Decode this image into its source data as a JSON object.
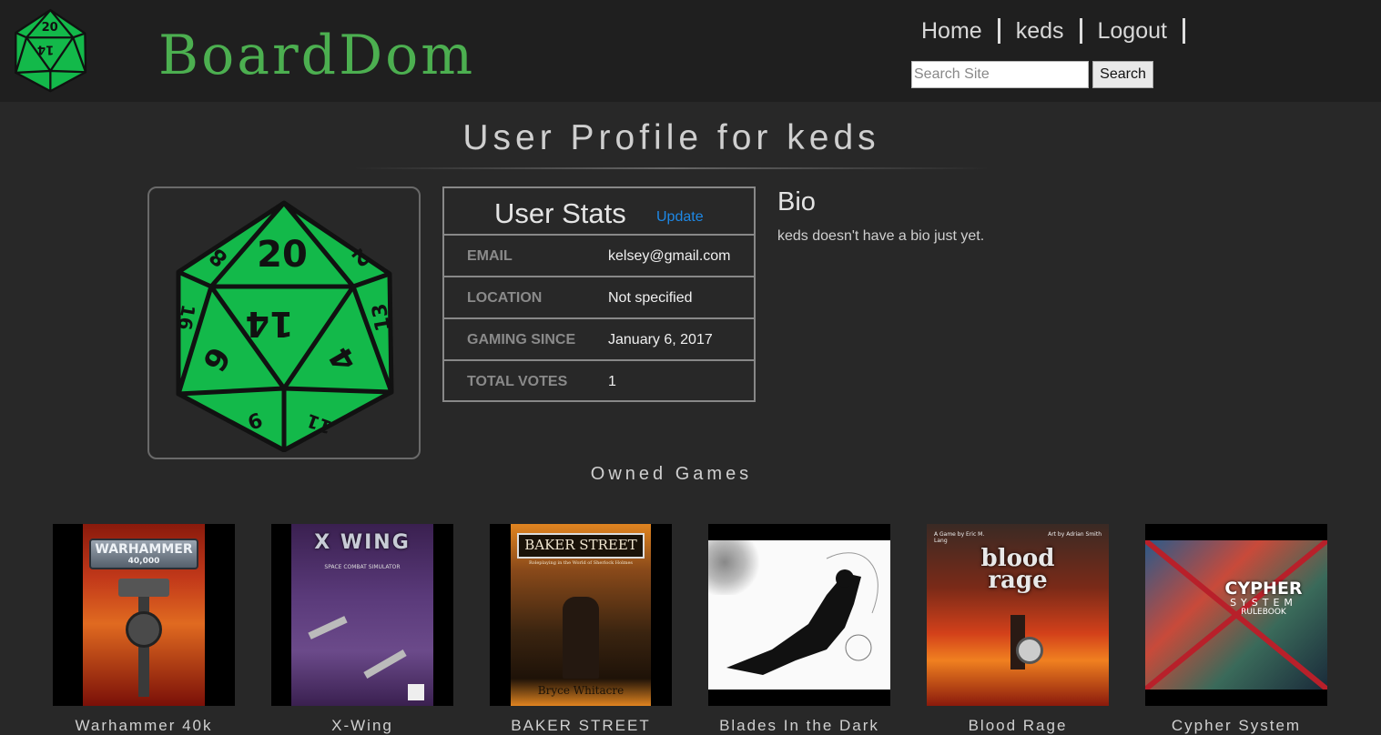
{
  "header": {
    "brand": "BoardDom",
    "logo_icon": "d20-die-icon",
    "nav": [
      {
        "label": "Home"
      },
      {
        "label": "keds"
      },
      {
        "label": "Logout"
      }
    ],
    "search": {
      "placeholder": "Search Site",
      "value": "",
      "button_label": "Search"
    }
  },
  "profile": {
    "title": "User Profile for keds",
    "avatar_icon": "d20-die-icon",
    "accent_color": "#13b94a"
  },
  "stats": {
    "title": "User Stats",
    "update_label": "Update",
    "rows": [
      {
        "label": "EMAIL",
        "value": "kelsey@gmail.com"
      },
      {
        "label": "LOCATION",
        "value": "Not specified"
      },
      {
        "label": "GAMING SINCE",
        "value": "January 6, 2017"
      },
      {
        "label": "TOTAL VOTES",
        "value": "1"
      }
    ]
  },
  "bio": {
    "title": "Bio",
    "text": "keds doesn't have a bio just yet."
  },
  "owned_games": {
    "title": "Owned Games",
    "items": [
      {
        "name": "Warhammer 40k",
        "art_title": "WARHAMMER",
        "art_sub": "40,000"
      },
      {
        "name": "X-Wing",
        "art_title": "X WING",
        "art_sub": "SPACE COMBAT SIMULATOR"
      },
      {
        "name": "BAKER STREET",
        "art_title": "BAKER STREET",
        "art_sub": "Roleplaying in the World of Sherlock Holmes",
        "art_author": "Bryce Whitacre"
      },
      {
        "name": "Blades In the Dark"
      },
      {
        "name": "Blood Rage",
        "art_title": "blood rage",
        "art_credit_left": "A Game by Eric M. Lang",
        "art_credit_right": "Art by Adrian Smith"
      },
      {
        "name": "Cypher System",
        "art_title": "CYPHER",
        "art_sub": "SYSTEM",
        "art_sub2": "RULEBOOK"
      }
    ]
  }
}
